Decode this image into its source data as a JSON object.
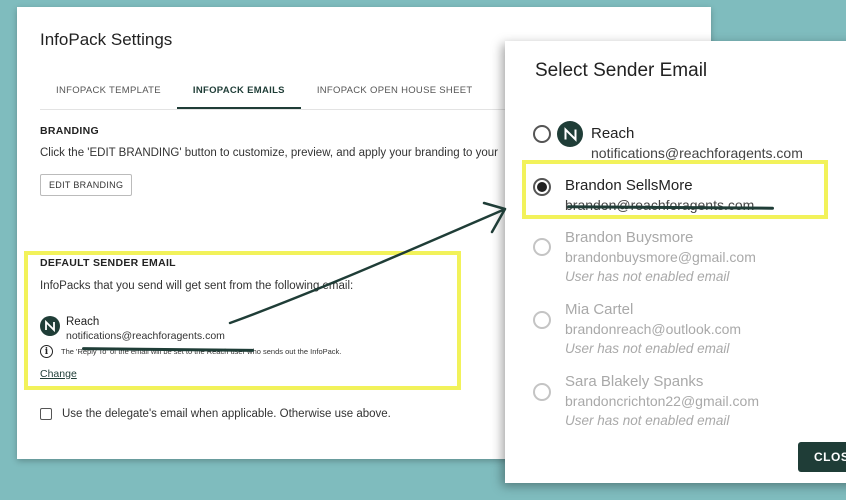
{
  "settings": {
    "title": "InfoPack Settings",
    "tabs": [
      {
        "label": "INFOPACK TEMPLATE",
        "active": false
      },
      {
        "label": "INFOPACK EMAILS",
        "active": true
      },
      {
        "label": "INFOPACK OPEN HOUSE SHEET",
        "active": false
      }
    ],
    "branding": {
      "heading": "BRANDING",
      "description": "Click the 'EDIT BRANDING' button to customize, preview, and apply your branding to your",
      "button_label": "EDIT BRANDING"
    },
    "default_sender": {
      "heading": "DEFAULT SENDER EMAIL",
      "description": "InfoPacks that you send will get sent from the following email:",
      "sender_name": "Reach",
      "sender_email": "notifications@reachforagents.com",
      "info_note": "The 'Reply To' of the email will be set to the Reach user who sends out the InfoPack.",
      "change_link": "Change"
    },
    "delegate_checkbox": {
      "label": "Use the delegate's email when applicable. Otherwise use above.",
      "checked": false
    }
  },
  "modal": {
    "title": "Select Sender Email",
    "options": [
      {
        "name": "Reach",
        "email": "notifications@reachforagents.com",
        "selected": false,
        "enabled": true,
        "has_logo": true,
        "note": ""
      },
      {
        "name": "Brandon SellsMore",
        "email": "brandon@reachforagents.com",
        "selected": true,
        "enabled": true,
        "has_logo": false,
        "note": ""
      },
      {
        "name": "Brandon Buysmore",
        "email": "brandonbuysmore@gmail.com",
        "selected": false,
        "enabled": false,
        "has_logo": false,
        "note": "User has not enabled email"
      },
      {
        "name": "Mia Cartel",
        "email": "brandonreach@outlook.com",
        "selected": false,
        "enabled": false,
        "has_logo": false,
        "note": "User has not enabled email"
      },
      {
        "name": "Sara Blakely Spanks",
        "email": "brandoncrichton22@gmail.com",
        "selected": false,
        "enabled": false,
        "has_logo": false,
        "note": "User has not enabled email"
      }
    ],
    "close_label": "CLOS"
  },
  "colors": {
    "background": "#7fbcbe",
    "brand_dark": "#1f3d37",
    "highlight": "#f2f25a",
    "disabled_text": "#a9a9a9"
  },
  "icons": {
    "logo": "reach-logo-icon",
    "info": "info-icon",
    "arrow": "annotation-arrow"
  }
}
